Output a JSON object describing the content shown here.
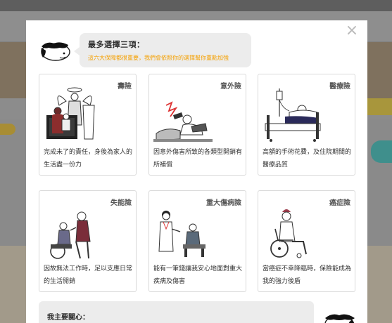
{
  "modal": {
    "close_label": "×",
    "prompt_title": "最多選擇三項：",
    "prompt_subtitle": "這六大保障都很重要，我們會依照你的選擇幫你重點加強",
    "concern_label": "我主要關心："
  },
  "cards": [
    {
      "title": "壽險",
      "desc": "完成未了的責任，身後為家人的生活盡一份力"
    },
    {
      "title": "意外險",
      "desc": "因意外傷害所致的各類型開銷有所補償"
    },
    {
      "title": "醫療險",
      "desc": "高額的手術花費，及住院期間的醫療品質"
    },
    {
      "title": "失能險",
      "desc": "因故無法工作時，足以支應日常的生活開銷"
    },
    {
      "title": "重大傷病險",
      "desc": "能有一筆錢讓我安心地面對重大疾病及傷害"
    },
    {
      "title": "癌症險",
      "desc": "當癌症不幸降臨時，保險能成為我的強力後盾"
    }
  ],
  "colors": {
    "accent": "#f5a000",
    "bubble_bg": "#ececec",
    "card_border": "#d9d9d9"
  },
  "icons": {
    "card_1": "angel-family-illustration",
    "card_2": "accident-illustration",
    "card_3": "hospital-bed-illustration",
    "card_4": "wheelchair-elder-illustration",
    "card_5": "doctor-patient-illustration",
    "card_6": "wheelchair-patient-illustration"
  }
}
